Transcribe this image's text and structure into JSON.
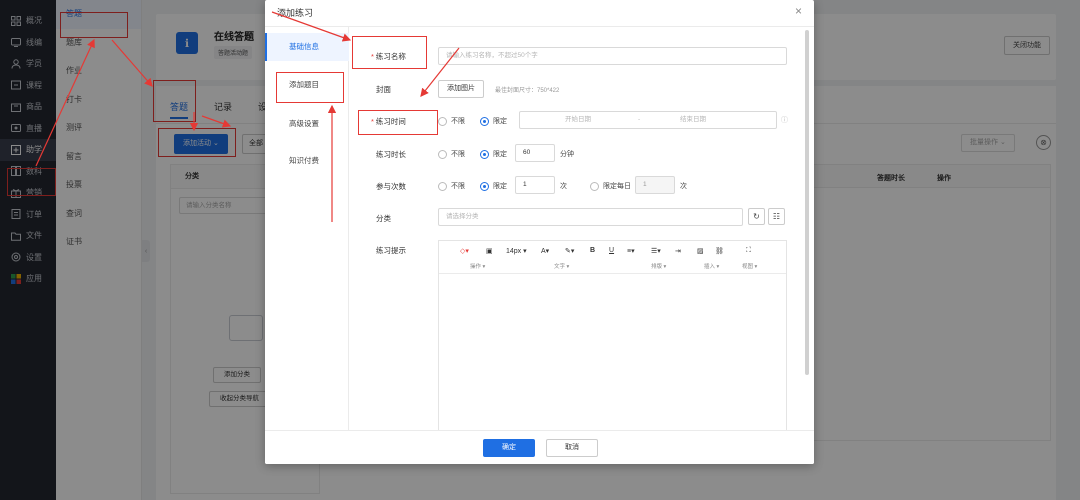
{
  "nav": {
    "items": [
      {
        "label": "概况",
        "icon": "grid-icon"
      },
      {
        "label": "线编",
        "icon": "tv-icon"
      },
      {
        "label": "学员",
        "icon": "user-icon"
      },
      {
        "label": "课程",
        "icon": "book-icon"
      },
      {
        "label": "商品",
        "icon": "bag-icon"
      },
      {
        "label": "直播",
        "icon": "video-icon"
      },
      {
        "label": "助学",
        "icon": "assist-icon"
      },
      {
        "label": "数科",
        "icon": "chart-icon"
      },
      {
        "label": "营销",
        "icon": "gift-icon"
      },
      {
        "label": "订单",
        "icon": "order-icon"
      },
      {
        "label": "文件",
        "icon": "folder-icon"
      },
      {
        "label": "设置",
        "icon": "gear-icon"
      },
      {
        "label": "应用",
        "icon": "apps-icon"
      }
    ]
  },
  "subnav": {
    "items": [
      "答题",
      "题库",
      "作业",
      "打卡",
      "测评",
      "留言",
      "投票",
      "查词",
      "证书"
    ]
  },
  "page": {
    "app_icon": "ℹ",
    "app_title": "在线答题",
    "app_sub": "答题活动题 ",
    "close_function": "关闭功能",
    "tabs": [
      "答题",
      "记录",
      "设置"
    ],
    "add_activity": "添加活动",
    "select_all": "全部",
    "batch_op": "批量操作",
    "category_header": "分类",
    "category_search_placeholder": "请输入分类名称",
    "add_category": "添加分类",
    "collapse_category": "收起分类导航",
    "col_duration": "答题时长",
    "col_operation": "操作"
  },
  "modal": {
    "title": "添加练习",
    "close": "×",
    "side": [
      "基础信息",
      "添加题目",
      "高级设置",
      "知识付费"
    ],
    "name_label": "练习名称",
    "name_placeholder": "请输入练习名称，不超过50个字",
    "cover_label": "封面",
    "cover_button": "添加图片",
    "cover_hint": "最佳封面尺寸：750*422",
    "time_label": "练习时间",
    "time_unlimited": "不限",
    "time_limited": "限定",
    "start_date": "开始日期",
    "date_sep": "-",
    "end_date": "结束日期",
    "duration_label": "练习时长",
    "duration_unlimited": "不限",
    "duration_limited": "限定",
    "duration_value": "60",
    "duration_unit": "分钟",
    "attempts_label": "参与次数",
    "attempts_unlimited": "不限",
    "attempts_limited": "限定",
    "attempts_value": "1",
    "attempts_unit": "次",
    "attempts_daily": "限定每日",
    "attempts_daily_value": "1",
    "attempts_daily_unit": "次",
    "category_label": "分类",
    "category_placeholder": "请选择分类",
    "tip_label": "练习提示",
    "editor": {
      "font_size": "14px",
      "bold": "B",
      "underline": "U",
      "groups": [
        "操作 ▾",
        "文字 ▾",
        "排版 ▾",
        "插入 ▾",
        "视图 ▾"
      ]
    },
    "ok": "确定",
    "cancel": "取消"
  },
  "colors": {
    "primary": "#1f6fe3",
    "annotation": "#e53935",
    "nav_bg": "#232731"
  }
}
